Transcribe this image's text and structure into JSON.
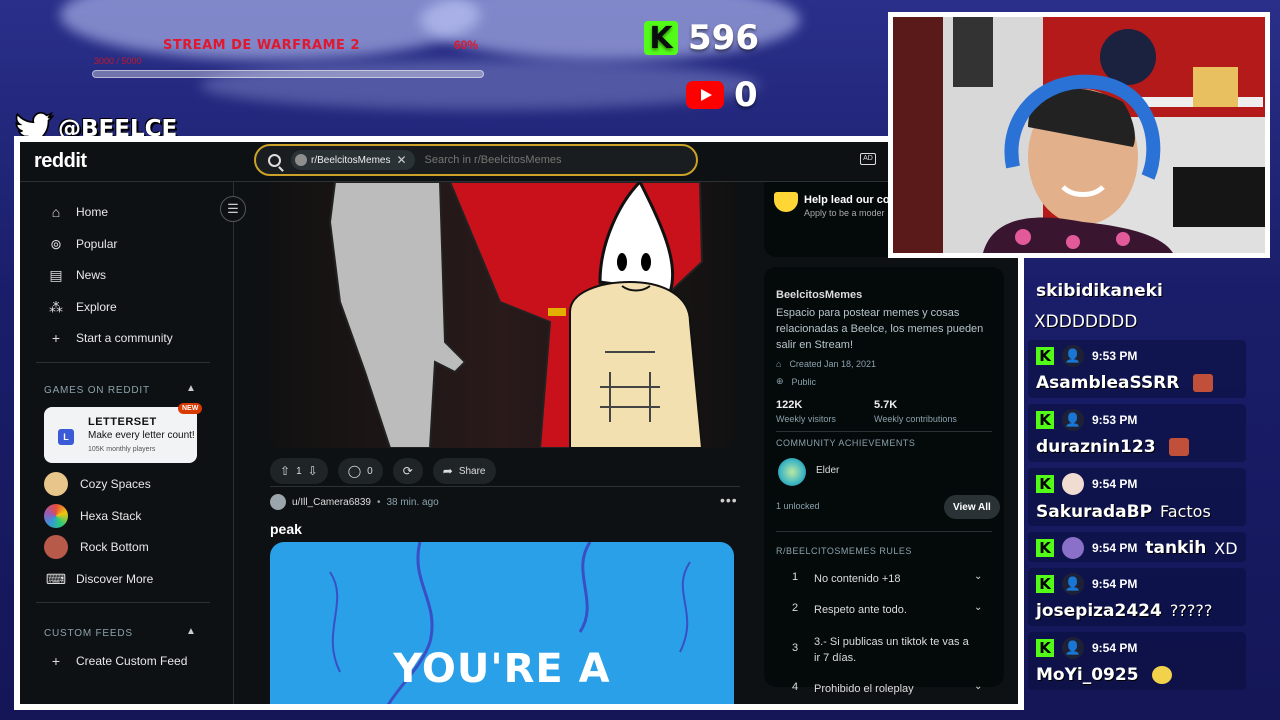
{
  "overlay": {
    "goal": {
      "title": "STREAM DE WARFRAME 2",
      "percent": "60%",
      "progress": 0.6,
      "sub": "3000 / 5000"
    },
    "kick_count": "596",
    "youtube_count": "0",
    "twitter_handle": "@BEELCE_"
  },
  "reddit": {
    "logo": "reddit",
    "search": {
      "community_chip": "r/BeelcitosMemes",
      "placeholder": "Search in r/BeelcitosMemes"
    },
    "nav": {
      "home": "Home",
      "popular": "Popular",
      "news": "News",
      "explore": "Explore",
      "start_community": "Start a community",
      "games_heading": "GAMES ON REDDIT",
      "letterset": {
        "title": "LETTERSET",
        "desc": "Make every letter count!",
        "players": "105K monthly players",
        "badge": "NEW",
        "icon_letter": "L"
      },
      "games": [
        "Cozy Spaces",
        "Hexa Stack",
        "Rock Bottom"
      ],
      "discover_more": "Discover More",
      "custom_feeds_heading": "CUSTOM FEEDS",
      "create_custom_feed": "Create Custom Feed"
    },
    "post1": {
      "upvotes": "1",
      "comments": "0",
      "share": "Share"
    },
    "post2": {
      "author": "u/Ill_Camera6839",
      "time": "38 min. ago",
      "title": "peak",
      "image_caption": "YOU'RE A"
    },
    "sidebar": {
      "help_title": "Help lead our cor",
      "help_sub": "Apply to be a moder",
      "community_name": "BeelcitosMemes",
      "description": "Espacio para postear memes y cosas relacionadas a Beelce, los memes pueden salir en Stream!",
      "created": "Created Jan 18, 2021",
      "visibility": "Public",
      "visitors_value": "122K",
      "visitors_label": "Weekly visitors",
      "contrib_value": "5.7K",
      "contrib_label": "Weekly contributions",
      "achievements_heading": "COMMUNITY ACHIEVEMENTS",
      "achievement_name": "Elder",
      "unlocked": "1 unlocked",
      "view_all": "View All",
      "rules_heading": "R/BEELCITOSMEMES RULES",
      "rules": [
        {
          "num": "1",
          "text": "No contenido +18"
        },
        {
          "num": "2",
          "text": "Respeto ante todo."
        },
        {
          "num": "3",
          "text": "3.- Si publicas un tiktok te vas a ir 7 días."
        },
        {
          "num": "4",
          "text": "Prohibido el roleplay"
        }
      ]
    }
  },
  "chat": {
    "top_user": "skibidikaneki",
    "top_text": "XDDDDDDD",
    "messages": [
      {
        "time": "9:53 PM",
        "user": "AsambleaSSRR",
        "text": ""
      },
      {
        "time": "9:53 PM",
        "user": "duraznin123",
        "text": ""
      },
      {
        "time": "9:54 PM",
        "user": "SakuradaBP",
        "text": "Factos"
      },
      {
        "time": "9:54 PM",
        "user": "tankih",
        "text": "XD"
      },
      {
        "time": "9:54 PM",
        "user": "josepiza2424",
        "text": "?????"
      },
      {
        "time": "9:54 PM",
        "user": "MoYi_0925",
        "text": ""
      }
    ],
    "kick_letter": "K"
  },
  "colors": {
    "kick_green": "#53fc18",
    "reddit_bg": "#0e1113",
    "goal_red": "#e0182d"
  }
}
